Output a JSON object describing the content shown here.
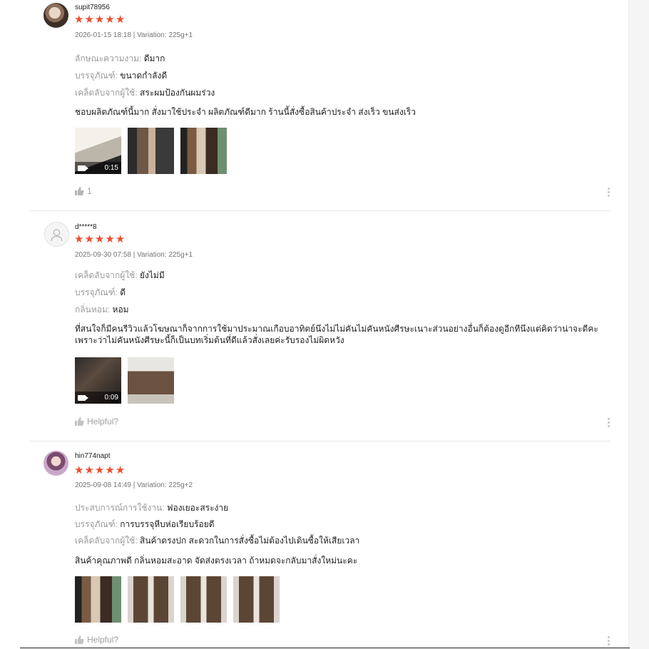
{
  "reviews": [
    {
      "username": "supit78956",
      "rating": 5,
      "meta": "2026-01-15 18:18 | Variation: 225g+1",
      "attributes": [
        {
          "label": "ลักษณะความงาม:",
          "value": "ดีมาก"
        },
        {
          "label": "บรรจุภัณฑ์:",
          "value": "ขนาดกำลังดี"
        },
        {
          "label": "เคล็ดลับจากผู้ใช้:",
          "value": "สระผมป้องกันผมร่วง"
        }
      ],
      "comment": "ชอบผลิตภัณฑ์นี้มาก สั่งมาใช้ประจำ ผลิตภัณฑ์ดีมาก ร้านนี้สั่งซื้อสินค้าประจำ ส่งเร็ว ขนส่งเร็ว",
      "video_duration": "0:15",
      "like_text": "1"
    },
    {
      "username": "d*****8",
      "rating": 5,
      "meta": "2025-09-30 07:58 | Variation: 225g+1",
      "attributes": [
        {
          "label": "เคล็ดลับจากผู้ใช้:",
          "value": "ยังไม่มี"
        },
        {
          "label": "บรรจุภัณฑ์:",
          "value": "ดี"
        },
        {
          "label": "กลิ่นหอม:",
          "value": "หอม"
        }
      ],
      "comment": "ที่สนใจก็มีคนรีวิวแล้วโฆษณาก็จากการใช้มาประมาณเกือบอาทิตย์นึงไม่ไม่คันไม่คันหนังศีรษะเนาะส่วนอย่างอื่นก็ต้องดูอีกทีนึงแต่คิดว่าน่าจะดีคะ เพราะว่าไม่คันหนังศีรษะนี้ก็เป็นบทเริ่มต้นที่ดีแล้วสั่งเลยค่ะรับรองไม่ผิดหวัง",
      "video_duration": "0:09",
      "like_text": "Helpful?"
    },
    {
      "username": "hin774napt",
      "rating": 5,
      "meta": "2025-09-08 14:49 | Variation: 225g+2",
      "attributes": [
        {
          "label": "ประสบการณ์การใช้งาน:",
          "value": "ฟองเยอะสระง่าย"
        },
        {
          "label": "บรรจุภัณฑ์:",
          "value": "การบรรจุหีบห่อเรียบร้อยดี"
        },
        {
          "label": "เคล็ดลับจากผู้ใช้:",
          "value": "สินค้าตรงปก สะดวกในการสั่งซื้อไม่ต้องไปเดินซื้อให้เสียเวลา"
        }
      ],
      "comment": "สินค้าคุณภาพดี กลิ่นหอมสะอาด จัดส่งตรงเวลา ถ้าหมดจะกลับมาสั่งใหม่นะคะ",
      "like_text": "Helpful?"
    }
  ],
  "icons": {
    "star": "star-icon",
    "like": "thumbs-up-icon",
    "more": "more-vertical-icon",
    "video": "video-camera-icon",
    "avatar": "user-silhouette-icon"
  },
  "colors": {
    "star": "#ee4d2d",
    "muted": "#a0a0a0"
  }
}
